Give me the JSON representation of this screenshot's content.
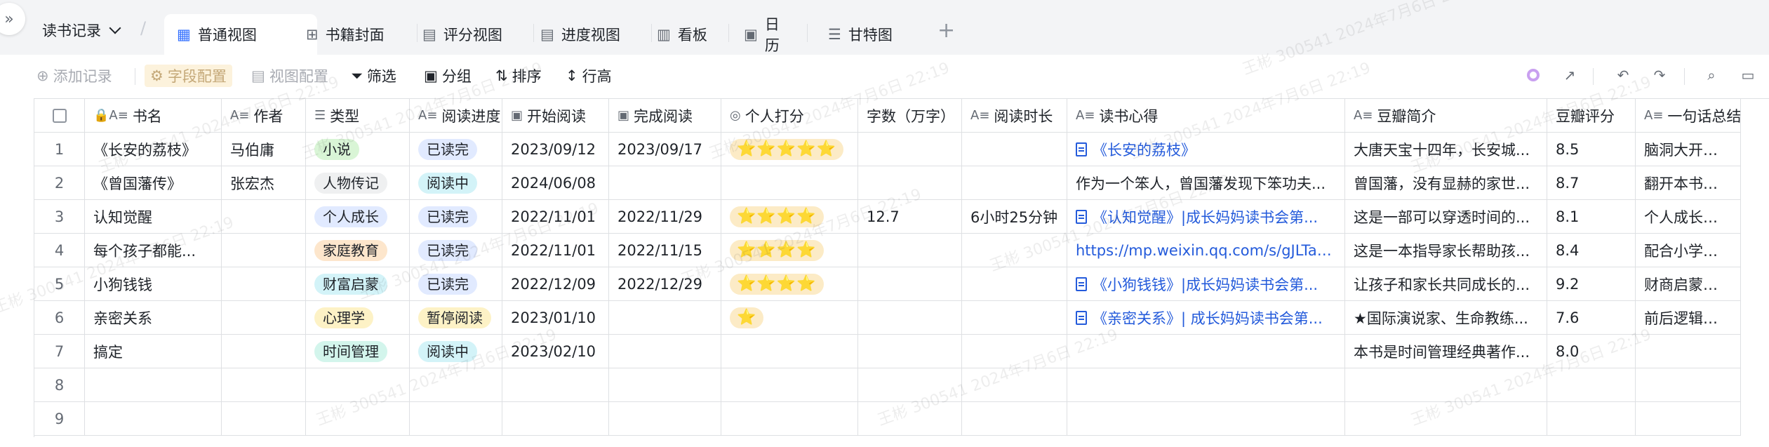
{
  "base_selector": "读书记录",
  "tabs": [
    {
      "label": "普通视图",
      "icon": "grid-icon",
      "active": true
    },
    {
      "label": "书籍封面",
      "icon": "gallery-icon",
      "active": false
    },
    {
      "label": "评分视图",
      "icon": "table-icon",
      "active": false
    },
    {
      "label": "进度视图",
      "icon": "table-icon",
      "active": false
    },
    {
      "label": "看板",
      "icon": "kanban-icon",
      "active": false
    },
    {
      "label": "日历",
      "icon": "calendar-icon",
      "active": false
    },
    {
      "label": "甘特图",
      "icon": "gantt-icon",
      "active": false
    }
  ],
  "toolbar": {
    "add_record": "添加记录",
    "field_config": "字段配置",
    "view_config": "视图配置",
    "filter": "筛选",
    "group": "分组",
    "sort": "排序",
    "row_height": "行高"
  },
  "columns": [
    "书名",
    "作者",
    "类型",
    "阅读进度",
    "开始阅读",
    "完成阅读",
    "个人打分",
    "字数（万字）",
    "阅读时长",
    "读书心得",
    "豆瓣简介",
    "豆瓣评分",
    "一句话总结"
  ],
  "rows": [
    {
      "no": "1",
      "title": "《长安的荔枝》",
      "author": "马伯庸",
      "type": "小说",
      "progress": "已读完",
      "start": "2023/09/12",
      "end": "2023/09/17",
      "stars": "⭐⭐⭐⭐⭐",
      "words": "",
      "duration": "",
      "note": "《长安的荔枝》",
      "note_link": true,
      "note_doc": true,
      "douban": "大唐天宝十四年，长安城...",
      "score": "8.5",
      "summary": "脑洞大开的马伯庸以"
    },
    {
      "no": "2",
      "title": "《曾国藩传》",
      "author": "张宏杰",
      "type": "人物传记",
      "progress": "阅读中",
      "start": "2024/06/08",
      "end": "",
      "stars": "",
      "words": "",
      "duration": "",
      "note": "作为一个笨人，曾国藩发现下笨功夫...",
      "note_link": false,
      "note_doc": false,
      "douban": "曾国藩，没有显赫的家世...",
      "score": "8.7",
      "summary": "翻开本书，看曾国藩"
    },
    {
      "no": "3",
      "title": "认知觉醒",
      "author": "",
      "type": "个人成长",
      "progress": "已读完",
      "start": "2022/11/01",
      "end": "2022/11/29",
      "stars": "⭐⭐⭐⭐",
      "words": "12.7",
      "duration": "6小时25分钟",
      "note": "《认知觉醒》|成长妈妈读书会第...",
      "note_link": true,
      "note_doc": true,
      "douban": "这是一部可以穿透时间的...",
      "score": "8.1",
      "summary": "个人成长类书籍综合"
    },
    {
      "no": "4",
      "title": "每个孩子都能...",
      "author": "",
      "type": "家庭教育",
      "progress": "已读完",
      "start": "2022/11/01",
      "end": "2022/11/15",
      "stars": "⭐⭐⭐⭐",
      "words": "",
      "duration": "",
      "note": "https://mp.weixin.qq.com/s/gJLTahR6...",
      "note_link": true,
      "note_doc": false,
      "douban": "这是一本指导家长帮助孩...",
      "score": "8.4",
      "summary": "配合小学语文教材，"
    },
    {
      "no": "5",
      "title": "小狗钱钱",
      "author": "",
      "type": "财富启蒙",
      "progress": "已读完",
      "start": "2022/12/09",
      "end": "2022/12/29",
      "stars": "⭐⭐⭐⭐",
      "words": "",
      "duration": "",
      "note": "《小狗钱钱》|成长妈妈读书会第...",
      "note_link": true,
      "note_doc": true,
      "douban": "让孩子和家长共同成长的...",
      "score": "9.2",
      "summary": "财商启蒙，适合亲子"
    },
    {
      "no": "6",
      "title": "亲密关系",
      "author": "",
      "type": "心理学",
      "progress": "暂停阅读",
      "start": "2023/01/10",
      "end": "",
      "stars": "⭐",
      "words": "",
      "duration": "",
      "note": "《亲密关系》| 成长妈妈读书会第...",
      "note_link": true,
      "note_doc": true,
      "douban": "★国际演说家、生命教练...",
      "score": "7.6",
      "summary": "前后逻辑感觉有点混"
    },
    {
      "no": "7",
      "title": "搞定",
      "author": "",
      "type": "时间管理",
      "progress": "阅读中",
      "start": "2023/02/10",
      "end": "",
      "stars": "",
      "words": "",
      "duration": "",
      "note": "",
      "note_link": false,
      "note_doc": false,
      "douban": "本书是时间管理经典著作...",
      "score": "8.0",
      "summary": ""
    },
    {
      "no": "8",
      "title": "",
      "author": "",
      "type": "",
      "progress": "",
      "start": "",
      "end": "",
      "stars": "",
      "words": "",
      "duration": "",
      "note": "",
      "note_link": false,
      "note_doc": false,
      "douban": "",
      "score": "",
      "summary": ""
    },
    {
      "no": "9",
      "title": "",
      "author": "",
      "type": "",
      "progress": "",
      "start": "",
      "end": "",
      "stars": "",
      "words": "",
      "duration": "",
      "note": "",
      "note_link": false,
      "note_doc": false,
      "douban": "",
      "score": "",
      "summary": ""
    }
  ],
  "type_colors": {
    "小说": "#d9f5d6",
    "人物传记": "#eff0f1",
    "个人成长": "#e1eaff",
    "家庭教育": "#fde6cc",
    "财富启蒙": "#d3f3f8",
    "心理学": "#fdf2c6",
    "时间管理": "#d3f5ec"
  },
  "progress_colors": {
    "已读完": "#e1eaff",
    "阅读中": "#d3f3f8",
    "暂停阅读": "#fdf2c6"
  },
  "watermark": "王彬 300541 2024年7月6日 22:19"
}
